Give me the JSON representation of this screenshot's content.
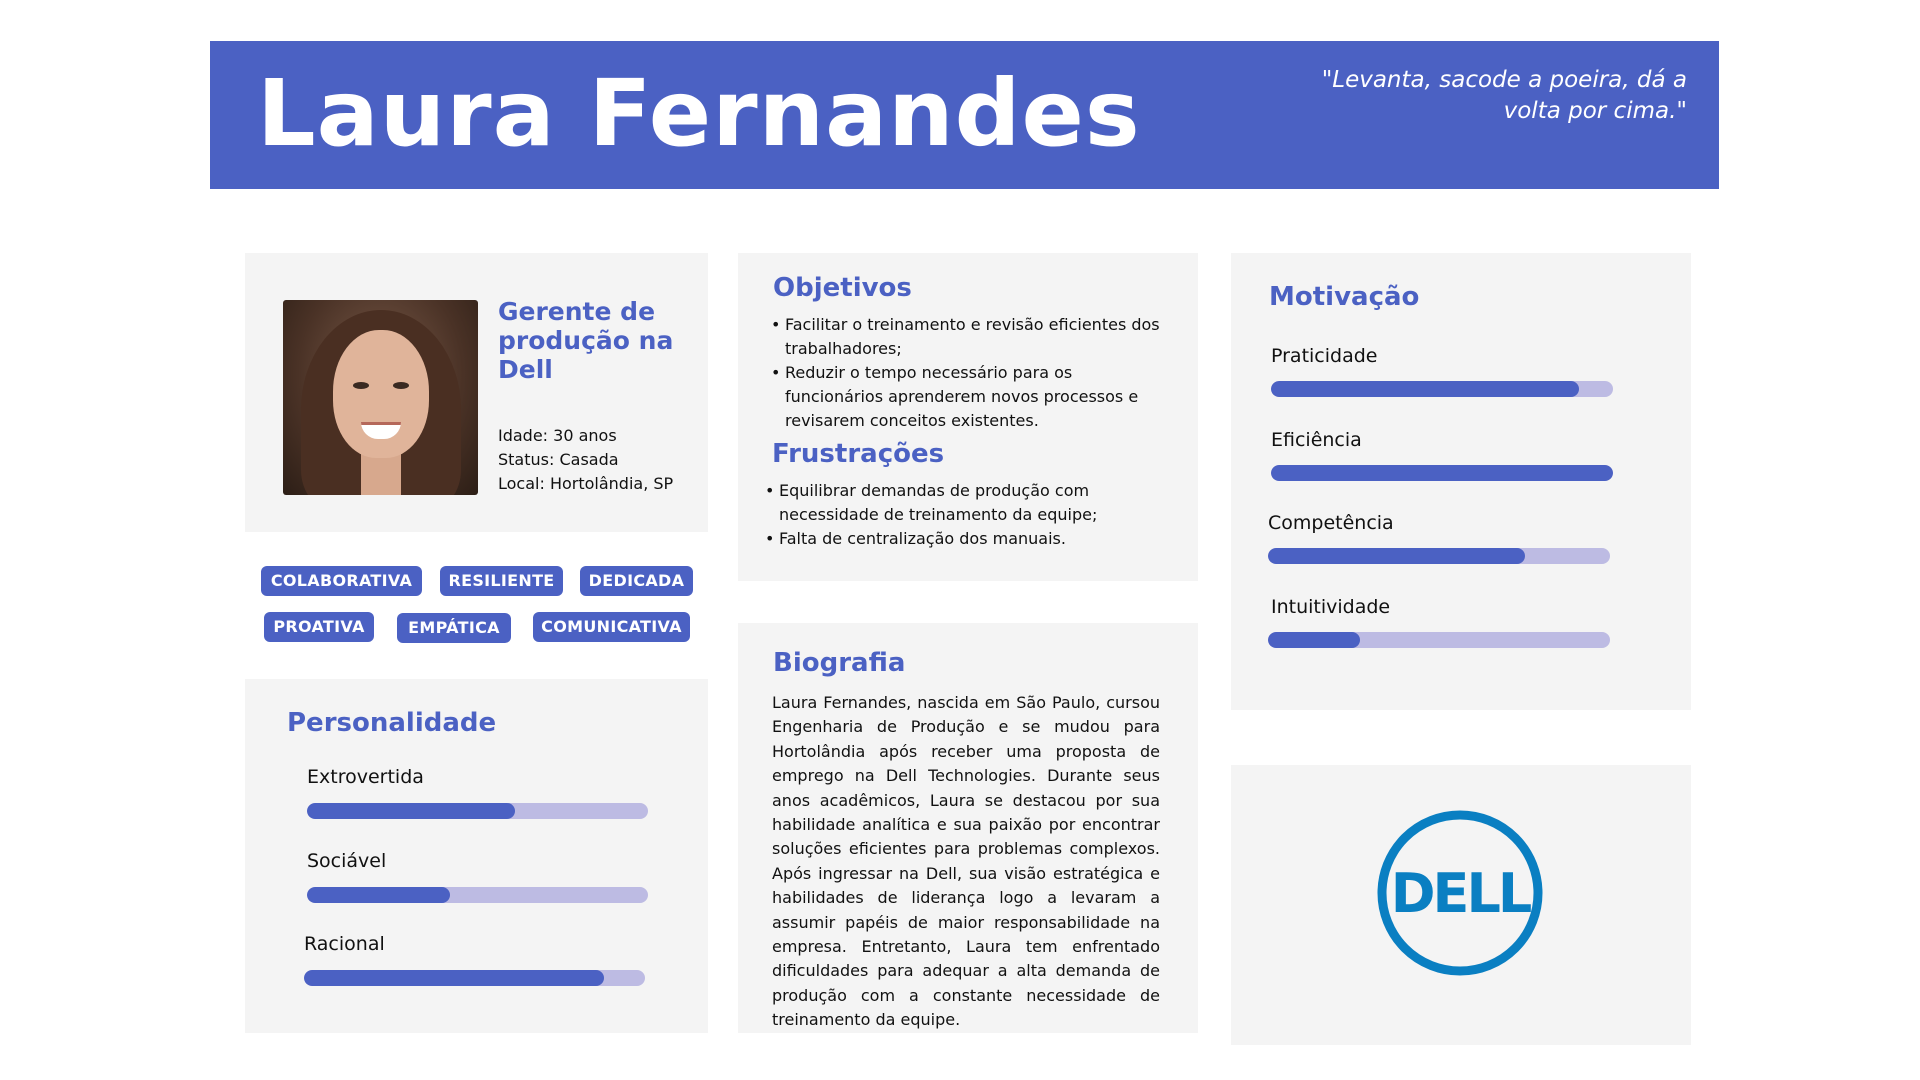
{
  "header": {
    "name": "Laura Fernandes",
    "quote": "\"Levanta, sacode a poeira, dá a volta por cima.\""
  },
  "profile": {
    "photo_alt": "avatar",
    "role": "Gerente de produção na Dell",
    "age": "Idade: 30 anos",
    "status": "Status: Casada",
    "location": "Local: Hortolândia, SP"
  },
  "tags": [
    "COLABORATIVA",
    "RESILIENTE",
    "DEDICADA",
    "PROATIVA",
    "EMPÁTICA",
    "COMUNICATIVA"
  ],
  "personality": {
    "title": "Personalidade",
    "traits": [
      {
        "label": "Extrovertida",
        "value": 0.61
      },
      {
        "label": "Sociável",
        "value": 0.42
      },
      {
        "label": "Racional",
        "value": 0.88
      }
    ]
  },
  "goals": {
    "title": "Objetivos",
    "items": [
      "Facilitar o treinamento e revisão eficientes dos trabalhadores;",
      "Reduzir o tempo necessário para os funcionários aprenderem novos processos e revisarem conceitos existentes."
    ]
  },
  "frustrations": {
    "title": "Frustrações",
    "items": [
      "Equilibrar demandas de produção com necessidade de treinamento da equipe;",
      "Falta de centralização dos manuais."
    ]
  },
  "biography": {
    "title": "Biografia",
    "text": "Laura Fernandes, nascida em São Paulo, cursou Engenharia de Produção e se mudou para Hortolândia após receber uma proposta de emprego na Dell Technologies. Durante seus anos acadêmicos, Laura se destacou por sua habilidade analítica e sua paixão por encontrar soluções eficientes para problemas complexos. Após ingressar na Dell, sua visão estratégica e habilidades de liderança logo a levaram a assumir papéis de maior responsabilidade na empresa. Entretanto, Laura tem enfrentado dificuldades para adequar a alta demanda de produção com a constante necessidade de treinamento da equipe."
  },
  "motivation": {
    "title": "Motivação",
    "items": [
      {
        "label": "Praticidade",
        "value": 0.9
      },
      {
        "label": "Eficiência",
        "value": 1.0
      },
      {
        "label": "Competência",
        "value": 0.75
      },
      {
        "label": "Intuitividade",
        "value": 0.27
      }
    ]
  },
  "logo": {
    "text": "DELL",
    "color": "#0a7fc2",
    "icon": "dell-logo-icon"
  },
  "colors": {
    "accent": "#4b61c3",
    "track": "#bdbbe3",
    "card": "#f4f4f4"
  }
}
